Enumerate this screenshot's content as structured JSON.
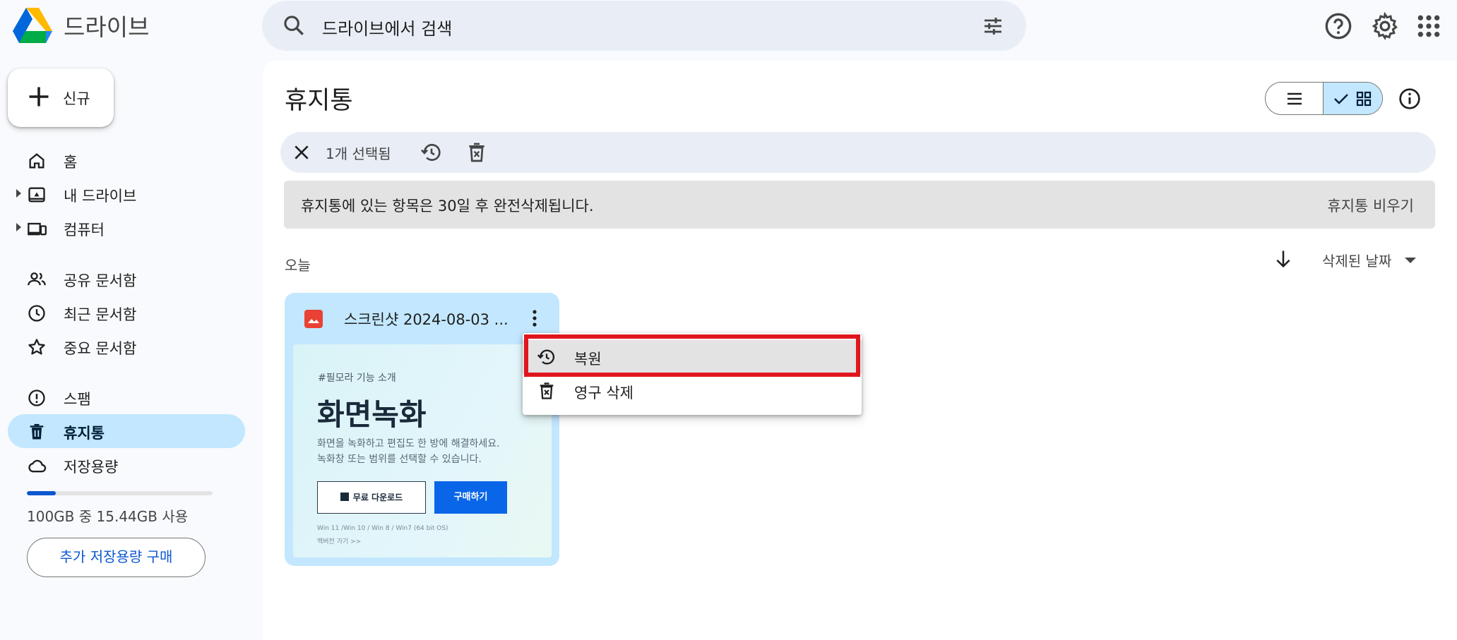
{
  "header": {
    "app_title": "드라이브",
    "search_placeholder": "드라이브에서 검색"
  },
  "sidebar": {
    "new_label": "신규",
    "items": [
      {
        "label": "홈"
      },
      {
        "label": "내 드라이브"
      },
      {
        "label": "컴퓨터"
      },
      {
        "label": "공유 문서함"
      },
      {
        "label": "최근 문서함"
      },
      {
        "label": "중요 문서함"
      },
      {
        "label": "스팸"
      },
      {
        "label": "휴지통"
      },
      {
        "label": "저장용량"
      }
    ],
    "storage_used_fraction": 0.1544,
    "storage_text": "100GB 중 15.44GB 사용",
    "buy_storage_label": "추가 저장용량 구매"
  },
  "main": {
    "title": "휴지통",
    "selection_count": "1개 선택됨",
    "notice": "휴지통에 있는 항목은 30일 후 완전삭제됩니다.",
    "empty_trash": "휴지통 비우기",
    "section": "오늘",
    "sort_label": "삭제된 날짜"
  },
  "file": {
    "name": "스크린샷 2024-08-03 ...",
    "thumb": {
      "tag": "#필모라 기능 소개",
      "headline": "화면녹화",
      "desc1": "화면을 녹화하고 편집도 한 방에 해결하세요.",
      "desc2": "녹화창 또는 범위를 선택할 수 있습니다.",
      "download": "무료 다운로드",
      "buy": "구매하기",
      "sys": "Win 11 /Win 10 / Win 8 / Win7 (64 bit OS)",
      "go": "맥버전 가기 >>"
    }
  },
  "context_menu": {
    "restore": "복원",
    "delete_forever": "영구 삭제"
  },
  "colors": {
    "accent": "#0b57d0",
    "active_bg": "#c2e7ff",
    "highlight_border": "#e0161e"
  }
}
